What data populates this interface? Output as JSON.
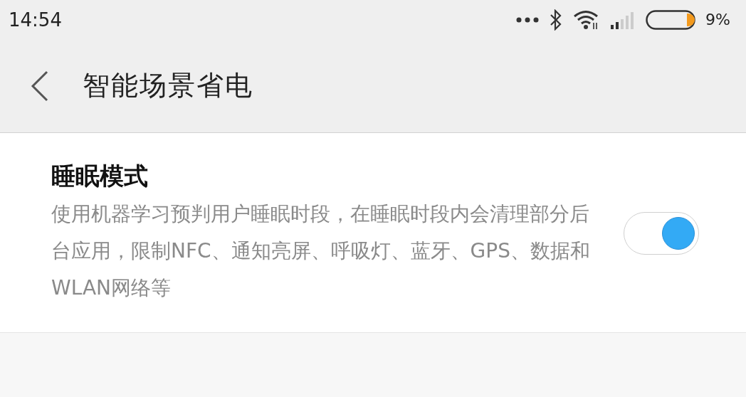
{
  "status_bar": {
    "time": "14:54",
    "battery_percent": "9%"
  },
  "header": {
    "title": "智能场景省电"
  },
  "settings": [
    {
      "title": "睡眠模式",
      "description": "使用机器学习预判用户睡眠时段，在睡眠时段内会清理部分后台应用，限制NFC、通知亮屏、呼吸灯、蓝牙、GPS、数据和WLAN网络等",
      "on": true
    }
  ]
}
